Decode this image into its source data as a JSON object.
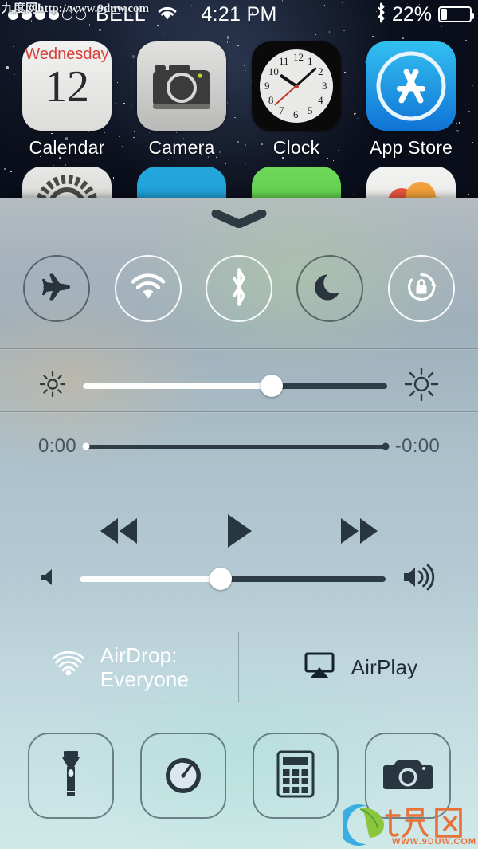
{
  "watermarks": {
    "top_text": "九度网http://www.9duw.com",
    "logo_text": "九度网",
    "logo_url": "WWW.9DUW.COM"
  },
  "status_bar": {
    "signal_dots_filled": 4,
    "signal_dots_total": 6,
    "carrier": "BELL",
    "wifi_icon": "wifi-icon",
    "time": "4:21 PM",
    "bluetooth_icon": "bluetooth-icon",
    "battery_percent_label": "22%",
    "battery_level": 22
  },
  "home_screen": {
    "apps": [
      {
        "label": "Calendar",
        "icon": "calendar-icon",
        "weekday": "Wednesday",
        "day": "12"
      },
      {
        "label": "Camera",
        "icon": "camera-icon"
      },
      {
        "label": "Clock",
        "icon": "clock-icon",
        "hour": 10,
        "minute": 8,
        "second": 38
      },
      {
        "label": "App Store",
        "icon": "app-store-icon"
      }
    ],
    "second_row_icons": [
      "settings-icon",
      "blue-app-icon",
      "green-app-icon",
      "photos-icon"
    ]
  },
  "control_center": {
    "grabber": "grabber-handle",
    "toggles": [
      {
        "name": "airplane-mode",
        "icon": "airplane-icon",
        "state": "off"
      },
      {
        "name": "wifi",
        "icon": "wifi-icon",
        "state": "on"
      },
      {
        "name": "bluetooth",
        "icon": "bluetooth-icon",
        "state": "on"
      },
      {
        "name": "do-not-disturb",
        "icon": "moon-icon",
        "state": "off"
      },
      {
        "name": "rotation-lock",
        "icon": "rotation-lock-icon",
        "state": "on"
      }
    ],
    "brightness": {
      "value": 62,
      "min_icon": "sun-small-icon",
      "max_icon": "sun-large-icon"
    },
    "media": {
      "elapsed_time": "0:00",
      "remaining_time": "-0:00",
      "progress": 0,
      "buttons": [
        {
          "name": "previous-track",
          "icon": "rewind-icon"
        },
        {
          "name": "play",
          "icon": "play-icon"
        },
        {
          "name": "next-track",
          "icon": "fast-forward-icon"
        }
      ],
      "volume": {
        "value": 46,
        "min_icon": "volume-mute-icon",
        "max_icon": "volume-high-icon"
      }
    },
    "airdrop": {
      "icon": "airdrop-icon",
      "label_line1": "AirDrop:",
      "label_line2": "Everyone",
      "state": "active"
    },
    "airplay": {
      "icon": "airplay-icon",
      "label": "AirPlay",
      "state": "inactive"
    },
    "shortcuts": [
      {
        "name": "flashlight",
        "icon": "flashlight-icon"
      },
      {
        "name": "timer",
        "icon": "timer-icon"
      },
      {
        "name": "calculator",
        "icon": "calculator-icon"
      },
      {
        "name": "camera",
        "icon": "camera-icon"
      }
    ]
  },
  "colors": {
    "toggle_on": "#ffffff",
    "toggle_off": "#2a343c",
    "slider_fill": "#fdfdfc",
    "slider_track": "#2e3c46",
    "media_icon": "#28363f",
    "time_text": "#46555f"
  }
}
